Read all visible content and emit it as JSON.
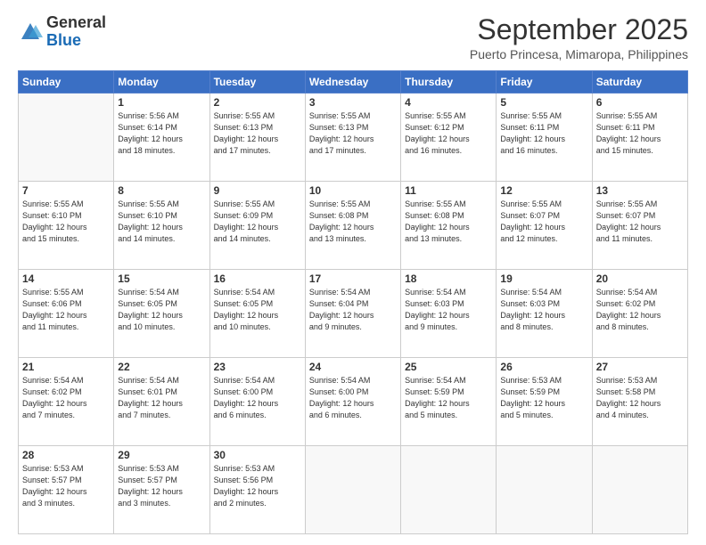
{
  "header": {
    "logo_general": "General",
    "logo_blue": "Blue",
    "month_title": "September 2025",
    "subtitle": "Puerto Princesa, Mimaropa, Philippines"
  },
  "weekdays": [
    "Sunday",
    "Monday",
    "Tuesday",
    "Wednesday",
    "Thursday",
    "Friday",
    "Saturday"
  ],
  "weeks": [
    [
      {
        "day": "",
        "info": ""
      },
      {
        "day": "1",
        "info": "Sunrise: 5:56 AM\nSunset: 6:14 PM\nDaylight: 12 hours\nand 18 minutes."
      },
      {
        "day": "2",
        "info": "Sunrise: 5:55 AM\nSunset: 6:13 PM\nDaylight: 12 hours\nand 17 minutes."
      },
      {
        "day": "3",
        "info": "Sunrise: 5:55 AM\nSunset: 6:13 PM\nDaylight: 12 hours\nand 17 minutes."
      },
      {
        "day": "4",
        "info": "Sunrise: 5:55 AM\nSunset: 6:12 PM\nDaylight: 12 hours\nand 16 minutes."
      },
      {
        "day": "5",
        "info": "Sunrise: 5:55 AM\nSunset: 6:11 PM\nDaylight: 12 hours\nand 16 minutes."
      },
      {
        "day": "6",
        "info": "Sunrise: 5:55 AM\nSunset: 6:11 PM\nDaylight: 12 hours\nand 15 minutes."
      }
    ],
    [
      {
        "day": "7",
        "info": "Sunrise: 5:55 AM\nSunset: 6:10 PM\nDaylight: 12 hours\nand 15 minutes."
      },
      {
        "day": "8",
        "info": "Sunrise: 5:55 AM\nSunset: 6:10 PM\nDaylight: 12 hours\nand 14 minutes."
      },
      {
        "day": "9",
        "info": "Sunrise: 5:55 AM\nSunset: 6:09 PM\nDaylight: 12 hours\nand 14 minutes."
      },
      {
        "day": "10",
        "info": "Sunrise: 5:55 AM\nSunset: 6:08 PM\nDaylight: 12 hours\nand 13 minutes."
      },
      {
        "day": "11",
        "info": "Sunrise: 5:55 AM\nSunset: 6:08 PM\nDaylight: 12 hours\nand 13 minutes."
      },
      {
        "day": "12",
        "info": "Sunrise: 5:55 AM\nSunset: 6:07 PM\nDaylight: 12 hours\nand 12 minutes."
      },
      {
        "day": "13",
        "info": "Sunrise: 5:55 AM\nSunset: 6:07 PM\nDaylight: 12 hours\nand 11 minutes."
      }
    ],
    [
      {
        "day": "14",
        "info": "Sunrise: 5:55 AM\nSunset: 6:06 PM\nDaylight: 12 hours\nand 11 minutes."
      },
      {
        "day": "15",
        "info": "Sunrise: 5:54 AM\nSunset: 6:05 PM\nDaylight: 12 hours\nand 10 minutes."
      },
      {
        "day": "16",
        "info": "Sunrise: 5:54 AM\nSunset: 6:05 PM\nDaylight: 12 hours\nand 10 minutes."
      },
      {
        "day": "17",
        "info": "Sunrise: 5:54 AM\nSunset: 6:04 PM\nDaylight: 12 hours\nand 9 minutes."
      },
      {
        "day": "18",
        "info": "Sunrise: 5:54 AM\nSunset: 6:03 PM\nDaylight: 12 hours\nand 9 minutes."
      },
      {
        "day": "19",
        "info": "Sunrise: 5:54 AM\nSunset: 6:03 PM\nDaylight: 12 hours\nand 8 minutes."
      },
      {
        "day": "20",
        "info": "Sunrise: 5:54 AM\nSunset: 6:02 PM\nDaylight: 12 hours\nand 8 minutes."
      }
    ],
    [
      {
        "day": "21",
        "info": "Sunrise: 5:54 AM\nSunset: 6:02 PM\nDaylight: 12 hours\nand 7 minutes."
      },
      {
        "day": "22",
        "info": "Sunrise: 5:54 AM\nSunset: 6:01 PM\nDaylight: 12 hours\nand 7 minutes."
      },
      {
        "day": "23",
        "info": "Sunrise: 5:54 AM\nSunset: 6:00 PM\nDaylight: 12 hours\nand 6 minutes."
      },
      {
        "day": "24",
        "info": "Sunrise: 5:54 AM\nSunset: 6:00 PM\nDaylight: 12 hours\nand 6 minutes."
      },
      {
        "day": "25",
        "info": "Sunrise: 5:54 AM\nSunset: 5:59 PM\nDaylight: 12 hours\nand 5 minutes."
      },
      {
        "day": "26",
        "info": "Sunrise: 5:53 AM\nSunset: 5:59 PM\nDaylight: 12 hours\nand 5 minutes."
      },
      {
        "day": "27",
        "info": "Sunrise: 5:53 AM\nSunset: 5:58 PM\nDaylight: 12 hours\nand 4 minutes."
      }
    ],
    [
      {
        "day": "28",
        "info": "Sunrise: 5:53 AM\nSunset: 5:57 PM\nDaylight: 12 hours\nand 3 minutes."
      },
      {
        "day": "29",
        "info": "Sunrise: 5:53 AM\nSunset: 5:57 PM\nDaylight: 12 hours\nand 3 minutes."
      },
      {
        "day": "30",
        "info": "Sunrise: 5:53 AM\nSunset: 5:56 PM\nDaylight: 12 hours\nand 2 minutes."
      },
      {
        "day": "",
        "info": ""
      },
      {
        "day": "",
        "info": ""
      },
      {
        "day": "",
        "info": ""
      },
      {
        "day": "",
        "info": ""
      }
    ]
  ]
}
